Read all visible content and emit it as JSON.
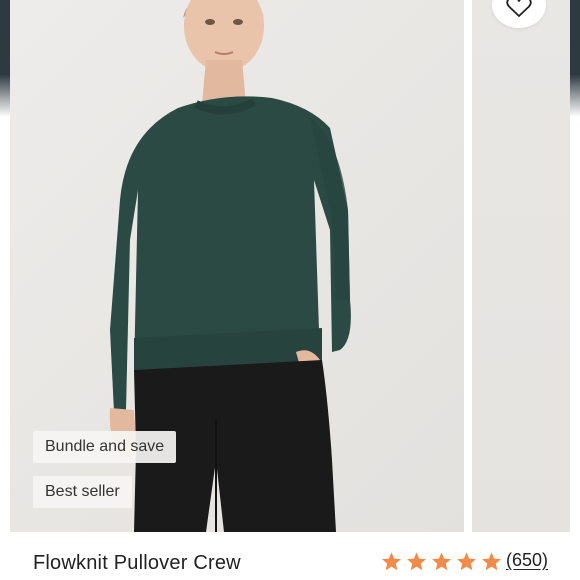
{
  "colors": {
    "star": "#f28b4a",
    "sweater": "#2c4a44",
    "pants": "#1a1a1a",
    "background": "#e9e7e4"
  },
  "favorite": {
    "icon": "heart-icon"
  },
  "badges": [
    {
      "label": "Bundle and save"
    },
    {
      "label": "Best seller"
    }
  ],
  "product": {
    "name": "Flowknit Pullover Crew",
    "rating": 5,
    "rating_icon": "star-icon",
    "review_count": "(650)"
  }
}
